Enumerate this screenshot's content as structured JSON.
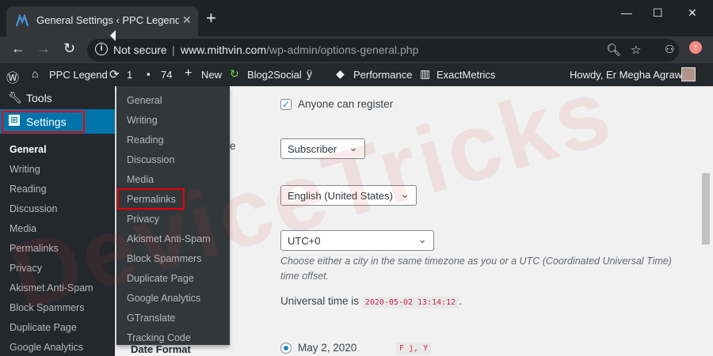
{
  "browser": {
    "tab_title": "General Settings ‹ PPC Legend —",
    "tab_close": "✕",
    "new_tab": "+",
    "window_controls": [
      "—",
      "☐",
      "✕"
    ],
    "not_secure": "Not secure",
    "url_host": "www.mithvin.com",
    "url_path": "/wp-admin/options-general.php"
  },
  "adminbar": {
    "site_name": "PPC Legend",
    "updates_count": "1",
    "comments_count": "74",
    "new_label": "New",
    "blog2social": "Blog2Social",
    "performance": "Performance",
    "exactmetrics": "ExactMetrics",
    "howdy": "Howdy, Er Megha Agrawal"
  },
  "menu": {
    "tools_label": "Tools",
    "settings_label": "Settings",
    "submenu": [
      "General",
      "Writing",
      "Reading",
      "Discussion",
      "Media",
      "Permalinks",
      "Privacy",
      "Akismet Anti-Spam",
      "Block Spammers",
      "Duplicate Page",
      "Google Analytics"
    ]
  },
  "flyout": {
    "items": [
      "General",
      "Writing",
      "Reading",
      "Discussion",
      "Media",
      "Permalinks",
      "Privacy",
      "Akismet Anti-Spam",
      "Block Spammers",
      "Duplicate Page",
      "Google Analytics",
      "GTranslate",
      "Tracking Code"
    ]
  },
  "content": {
    "anyone_can_register": "Anyone can register",
    "default_role": "Subscriber",
    "site_language": "English (United States)",
    "timezone": "UTC+0",
    "timezone_desc": "Choose either a city in the same timezone as you or a UTC (Coordinated Universal Time) time offset.",
    "universal_time_label": "Universal time is",
    "universal_time_value": "2020-05-02 13:14:12",
    "universal_time_suffix": ".",
    "partial_label": "e",
    "date_format_label": "Date Format",
    "date_format_option": "May 2, 2020",
    "date_format_code": "F j, Y"
  },
  "watermark": "DeviceTricks",
  "colors": {
    "wp_blue": "#0073aa",
    "adminbar": "#23282d",
    "highlight_red": "#ee0000"
  }
}
